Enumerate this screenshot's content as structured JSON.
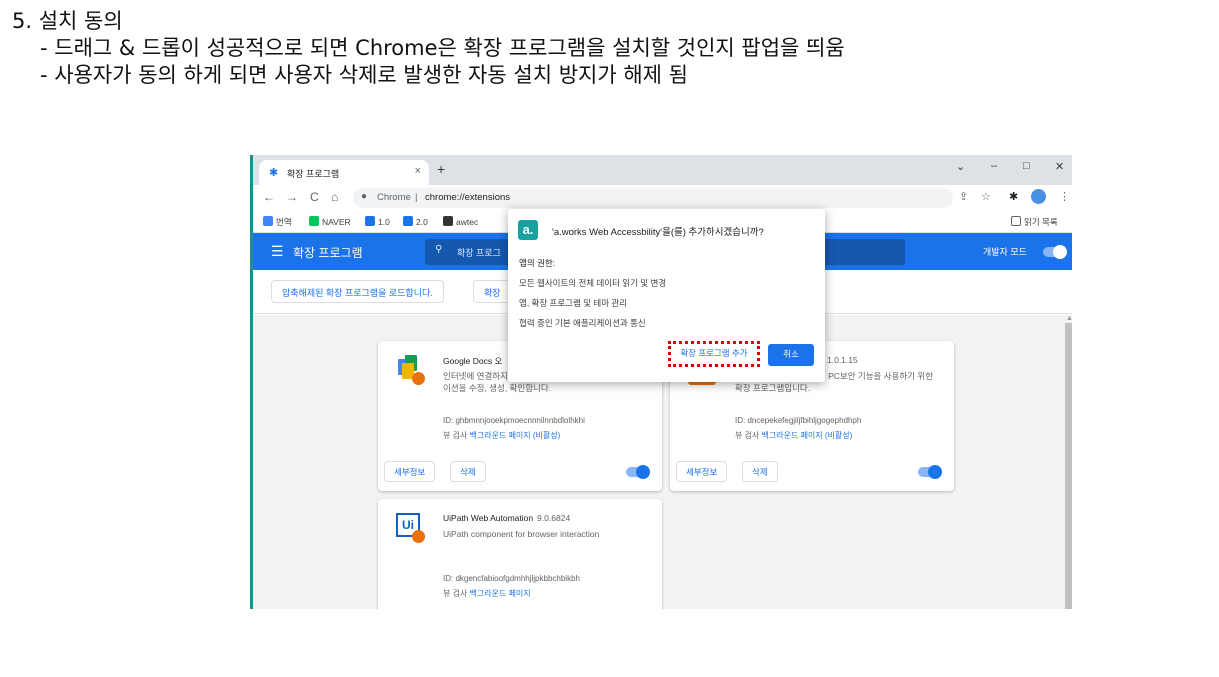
{
  "slide": {
    "heading": "5. 설치 동의",
    "bullet1": "- 드래그 & 드롭이 성공적으로 되면 Chrome은 확장 프로그램을 설치할 것인지 팝업을 띄움",
    "bullet2": "- 사용자가 동의 하게 되면 사용자 삭제로 발생한 자동 설치 방지가 해제 됨"
  },
  "browser": {
    "tab_title": "확장 프로그램",
    "tab_close": "×",
    "new_tab": "+",
    "win_min": "–",
    "win_max": "□",
    "win_close": "✕",
    "win_chevron": "⌄",
    "nav_back": "←",
    "nav_forward": "→",
    "nav_reload": "C",
    "nav_home": "⌂",
    "omni_site": "Chrome",
    "omni_url": "chrome://extensions",
    "bookmarks": [
      {
        "label": "번역",
        "color": "#4285f4"
      },
      {
        "label": "NAVER",
        "color": "#03c75a"
      },
      {
        "label": "1.0",
        "color": "#1a73e8"
      },
      {
        "label": "2.0",
        "color": "#1a73e8"
      },
      {
        "label": "awtec",
        "color": "#333333"
      }
    ],
    "reading_list": "읽기 목록"
  },
  "extensions_page": {
    "menu_icon": "☰",
    "title": "확장 프로그램",
    "search_placeholder": "확장 프로그",
    "dev_mode_label": "개발자 모드",
    "load_unpacked": "압축해제된 확장 프로그램을 로드합니다.",
    "pack_partial": "확장",
    "cards": [
      {
        "name": "Google Docs 오",
        "version": "",
        "description": "인터넷에 연결하지 않고도 문서, 스프레드시트 및 프레젠테이션을 수정, 생성, 확인합니다.",
        "id": "ID: ghbmnnjooekpmoecnnnilnnbdlolhkhi",
        "view_prefix": "뷰 검사",
        "view_link": "백그라운드 페이지 (비활성)",
        "details": "세부정보",
        "remove": "삭제",
        "enabled": true
      },
      {
        "name": "",
        "version": "1.0.1.15",
        "description": "오프라인 상태에서 웨어의 PC보안 기능을 사용하기 위한 확장 프로그램입니다.",
        "id": "ID: dncepekefegjiljfbihljgogephdhph",
        "view_prefix": "뷰 검사",
        "view_link": "백그라운드 페이지 (비활성)",
        "details": "세부정보",
        "remove": "삭제",
        "enabled": true
      },
      {
        "name": "UiPath Web Automation",
        "version": "9.0.6824",
        "description": "UiPath component for browser interaction",
        "id": "ID: dkgencfabioofgdmhhjljpkbbchbikbh",
        "view_prefix": "뷰 검사",
        "view_link": "백그라운드 페이지",
        "details": "",
        "remove": "",
        "enabled": true
      }
    ]
  },
  "dialog": {
    "logo": "a.",
    "title": "'a.works Web Accessbility'을(를) 추가하시겠습니까?",
    "perm_head": "앱의 권한:",
    "permissions": [
      "모든 웹사이트의 전체 데이터 읽기 및 변경",
      "앱, 확장 프로그램 및 테마 관리",
      "협력 중인 기본 애플리케이션과 통신"
    ],
    "add_button": "확장 프로그램 추가",
    "cancel_button": "취소"
  },
  "colors": {
    "chrome_blue": "#1a73e8",
    "highlight_red": "#e00000",
    "teal": "#17a2a0"
  }
}
